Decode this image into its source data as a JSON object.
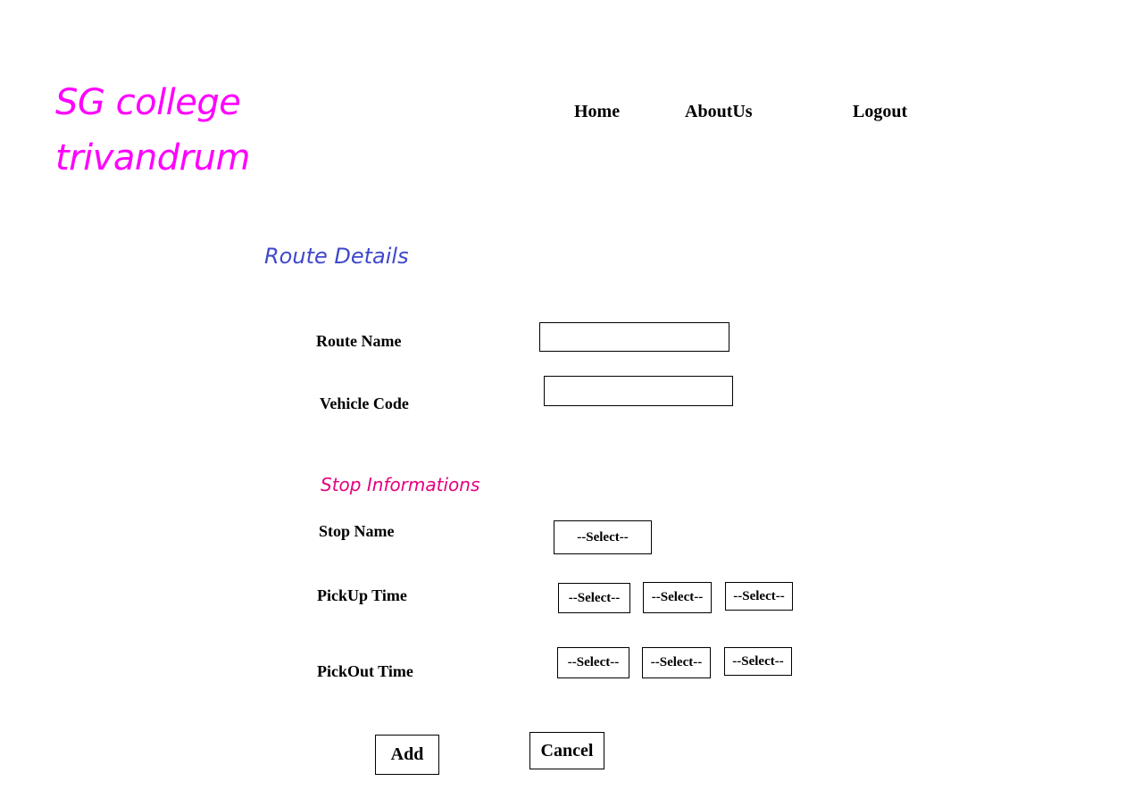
{
  "brand": {
    "line1": "SG college",
    "line2": "trivandrum"
  },
  "nav": {
    "home": "Home",
    "about": "AboutUs",
    "logout": "Logout"
  },
  "route": {
    "title": "Route Details",
    "route_name_label": "Route Name",
    "route_name_value": "",
    "vehicle_code_label": "Vehicle Code",
    "vehicle_code_value": ""
  },
  "stop": {
    "title": "Stop Informations",
    "stop_name_label": "Stop Name",
    "stop_name_select": "--Select--",
    "pickup_label": "PickUp Time",
    "pickup_selects": [
      "--Select--",
      "--Select--",
      "--Select--"
    ],
    "pickout_label": "PickOut Time",
    "pickout_selects": [
      "--Select--",
      "--Select--",
      "--Select--"
    ]
  },
  "actions": {
    "add": "Add",
    "cancel": "Cancel"
  },
  "colors": {
    "brand": "#ff00ff",
    "route_title": "#3f48cc",
    "stop_title": "#e6007e"
  }
}
